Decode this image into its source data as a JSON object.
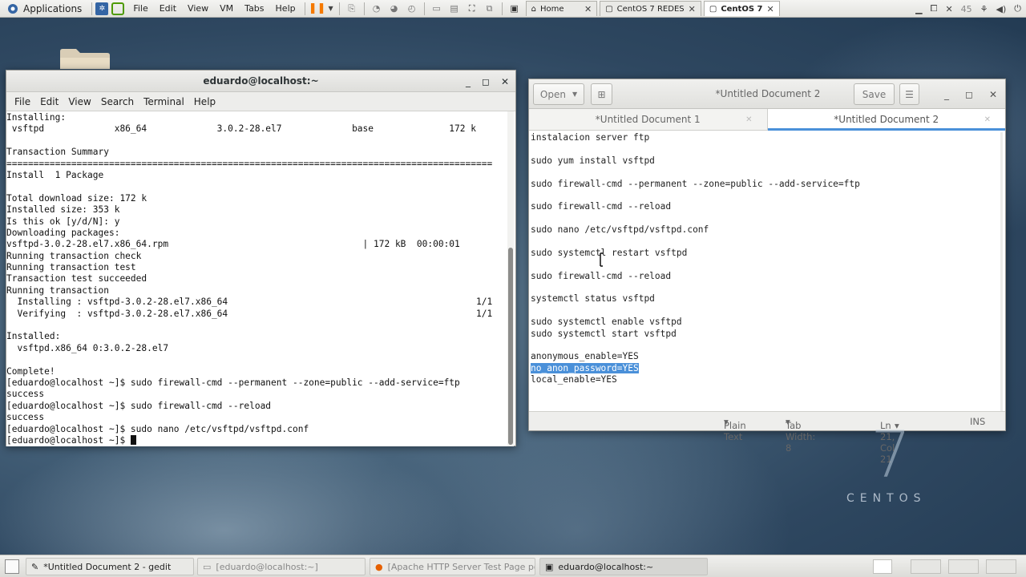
{
  "topbar": {
    "applications_label": "Applications",
    "menus": [
      "File",
      "Edit",
      "View",
      "VM",
      "Tabs",
      "Help"
    ],
    "tabs": [
      {
        "label": "Home",
        "icon": "home-icon",
        "active": false
      },
      {
        "label": "CentOS 7 REDES",
        "icon": "vm-icon",
        "active": false
      },
      {
        "label": "CentOS 7",
        "icon": "vm-icon",
        "active": true
      }
    ],
    "clock_fragment": "45"
  },
  "terminal": {
    "title": "eduardo@localhost:~",
    "menus": [
      "File",
      "Edit",
      "View",
      "Search",
      "Terminal",
      "Help"
    ],
    "lines": [
      "Installing:",
      " vsftpd             x86_64             3.0.2-28.el7             base              172 k",
      "",
      "Transaction Summary",
      "==========================================================================================",
      "Install  1 Package",
      "",
      "Total download size: 172 k",
      "Installed size: 353 k",
      "Is this ok [y/d/N]: y",
      "Downloading packages:",
      "vsftpd-3.0.2-28.el7.x86_64.rpm                                    | 172 kB  00:00:01",
      "Running transaction check",
      "Running transaction test",
      "Transaction test succeeded",
      "Running transaction",
      "  Installing : vsftpd-3.0.2-28.el7.x86_64                                              1/1",
      "  Verifying  : vsftpd-3.0.2-28.el7.x86_64                                              1/1",
      "",
      "Installed:",
      "  vsftpd.x86_64 0:3.0.2-28.el7",
      "",
      "Complete!",
      "[eduardo@localhost ~]$ sudo firewall-cmd --permanent --zone=public --add-service=ftp",
      "success",
      "[eduardo@localhost ~]$ sudo firewall-cmd --reload",
      "success",
      "[eduardo@localhost ~]$ sudo nano /etc/vsftpd/vsftpd.conf"
    ],
    "prompt": "[eduardo@localhost ~]$ "
  },
  "gedit": {
    "title": "*Untitled Document 2",
    "open_label": "Open",
    "save_label": "Save",
    "tabs": [
      {
        "label": "*Untitled Document 1",
        "active": false
      },
      {
        "label": "*Untitled Document 2",
        "active": true
      }
    ],
    "lines": [
      "instalacion server ftp",
      "",
      "sudo yum install vsftpd",
      "",
      "sudo firewall-cmd --permanent --zone=public --add-service=ftp",
      "",
      "sudo firewall-cmd --reload",
      "",
      "sudo nano /etc/vsftpd/vsftpd.conf",
      "",
      "sudo systemctl restart vsftpd",
      "",
      "sudo firewall-cmd --reload",
      "",
      "systemctl status vsftpd",
      "",
      "sudo systemctl enable vsftpd",
      "sudo systemctl start vsftpd",
      "",
      "anonymous_enable=YES",
      "no_anon_password=YES",
      "local_enable=YES"
    ],
    "selected_line": "no_anon_password=YES",
    "status": {
      "language": "Plain Text",
      "tab_width": "Tab Width: 8",
      "position": "Ln 21, Col 21",
      "mode": "INS"
    }
  },
  "watermark": {
    "number": "7",
    "word": "CENTOS"
  },
  "taskbar": {
    "tasks": [
      {
        "label": "*Untitled Document 2 - gedit",
        "state": "normal"
      },
      {
        "label": "[eduardo@localhost:~]",
        "state": "inactive"
      },
      {
        "label": "[Apache HTTP Server Test Page po...",
        "state": "inactive"
      },
      {
        "label": "eduardo@localhost:~",
        "state": "active"
      }
    ]
  },
  "colors": {
    "selection": "#4a90d9",
    "terminal_bg": "#ffffff",
    "desktop": "#3a5670"
  }
}
